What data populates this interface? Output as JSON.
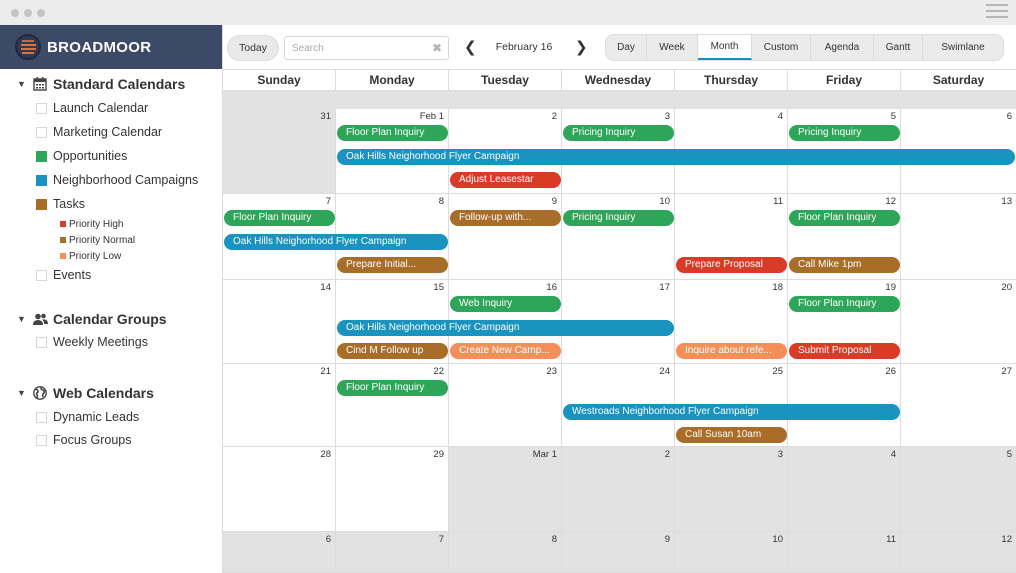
{
  "window": {
    "menu_icon": "hamburger-icon"
  },
  "brand": {
    "name": "BROADMOOR",
    "logo_icon": "broadmoor-logo-icon"
  },
  "colors": {
    "opportunities": "#2ea65a",
    "campaigns": "#1993bf",
    "tasks": "#a86d28",
    "priority_high": "#d93b27",
    "priority_normal": "#a86d28",
    "priority_low": "#f58f59",
    "brand_bg": "#3c4a68",
    "active_tab_underline": "#1a8ec0"
  },
  "sidebar": {
    "standard": {
      "title": "Standard Calendars",
      "icon": "calendar-icon",
      "items": [
        {
          "label": "Launch Calendar",
          "color": null
        },
        {
          "label": "Marketing Calendar",
          "color": null
        },
        {
          "label": "Opportunities",
          "color": "#2ea65a"
        },
        {
          "label": "Neighborhood Campaigns",
          "color": "#1993bf"
        },
        {
          "label": "Tasks",
          "color": "#a86d28"
        }
      ],
      "sub_items": [
        {
          "label": "Priority High",
          "color": "#d93b27"
        },
        {
          "label": "Priority Normal",
          "color": "#a86d28"
        },
        {
          "label": "Priority Low",
          "color": "#f58f59"
        }
      ],
      "events": {
        "label": "Events",
        "color": null
      }
    },
    "groups": {
      "title": "Calendar Groups",
      "icon": "users-icon",
      "items": [
        {
          "label": "Weekly Meetings"
        }
      ]
    },
    "web": {
      "title": "Web Calendars",
      "icon": "globe-icon",
      "items": [
        {
          "label": "Dynamic Leads"
        },
        {
          "label": "Focus Groups"
        }
      ]
    }
  },
  "toolbar": {
    "today_label": "Today",
    "search_placeholder": "Search",
    "search_value": "",
    "date_label": "February 16",
    "views": [
      "Day",
      "Week",
      "Month",
      "Custom",
      "Agenda",
      "Gantt",
      "Swimlane"
    ],
    "active_view": "Month"
  },
  "calendar": {
    "days_of_week": [
      "Sunday",
      "Monday",
      "Tuesday",
      "Wednesday",
      "Thursday",
      "Friday",
      "Saturday"
    ],
    "weeks": [
      {
        "days": [
          "31",
          "Feb 1",
          "2",
          "3",
          "4",
          "5",
          "6"
        ],
        "out": [
          true,
          false,
          false,
          false,
          false,
          false,
          false
        ],
        "events": [
          {
            "title": "Floor Plan Inquiry",
            "start": 1,
            "span": 1,
            "lane": 0,
            "type": "opportunities"
          },
          {
            "title": "Pricing Inquiry",
            "start": 3,
            "span": 1,
            "lane": 0,
            "type": "opportunities"
          },
          {
            "title": "Pricing Inquiry",
            "start": 5,
            "span": 1,
            "lane": 0,
            "type": "opportunities"
          },
          {
            "title": "Oak Hills Neighorhood Flyer Campaign",
            "start": 1,
            "span": 6,
            "lane": 1,
            "type": "campaigns"
          },
          {
            "title": "Adjust Leasestar",
            "start": 2,
            "span": 1,
            "lane": 2,
            "type": "priority_high"
          }
        ]
      },
      {
        "days": [
          "7",
          "8",
          "9",
          "10",
          "11",
          "12",
          "13"
        ],
        "out": [
          false,
          false,
          false,
          false,
          false,
          false,
          false
        ],
        "events": [
          {
            "title": "Floor Plan Inquiry",
            "start": 0,
            "span": 1,
            "lane": 0,
            "type": "opportunities"
          },
          {
            "title": "Follow-up with...",
            "start": 2,
            "span": 1,
            "lane": 0,
            "type": "priority_normal"
          },
          {
            "title": "Pricing Inquiry",
            "start": 3,
            "span": 1,
            "lane": 0,
            "type": "opportunities"
          },
          {
            "title": "Floor Plan Inquiry",
            "start": 5,
            "span": 1,
            "lane": 0,
            "type": "opportunities"
          },
          {
            "title": "Oak Hills Neighorhood Flyer Campaign",
            "start": 0,
            "span": 2,
            "lane": 1,
            "type": "campaigns"
          },
          {
            "title": "Prepare Initial...",
            "start": 1,
            "span": 1,
            "lane": 2,
            "type": "priority_normal"
          },
          {
            "title": "Prepare Proposal",
            "start": 4,
            "span": 1,
            "lane": 2,
            "type": "priority_high"
          },
          {
            "title": "Call Mike 1pm",
            "start": 5,
            "span": 1,
            "lane": 2,
            "type": "priority_normal"
          }
        ]
      },
      {
        "days": [
          "14",
          "15",
          "16",
          "17",
          "18",
          "19",
          "20"
        ],
        "out": [
          false,
          false,
          false,
          false,
          false,
          false,
          false
        ],
        "events": [
          {
            "title": "Web Inquiry",
            "start": 2,
            "span": 1,
            "lane": 0,
            "type": "opportunities"
          },
          {
            "title": "Floor Plan Inquiry",
            "start": 5,
            "span": 1,
            "lane": 0,
            "type": "opportunities"
          },
          {
            "title": "Oak Hills Neighorhood Flyer Campaign",
            "start": 1,
            "span": 3,
            "lane": 1,
            "type": "campaigns"
          },
          {
            "title": "Cind M Follow up",
            "start": 1,
            "span": 1,
            "lane": 2,
            "type": "priority_normal"
          },
          {
            "title": "Create New Camp...",
            "start": 2,
            "span": 1,
            "lane": 2,
            "type": "priority_low"
          },
          {
            "title": "Inquire about refe...",
            "start": 4,
            "span": 1,
            "lane": 2,
            "type": "priority_low"
          },
          {
            "title": "Submit Proposal",
            "start": 5,
            "span": 1,
            "lane": 2,
            "type": "priority_high"
          }
        ]
      },
      {
        "days": [
          "21",
          "22",
          "23",
          "24",
          "25",
          "26",
          "27"
        ],
        "out": [
          false,
          false,
          false,
          false,
          false,
          false,
          false
        ],
        "events": [
          {
            "title": "Floor Plan Inquiry",
            "start": 1,
            "span": 1,
            "lane": 0,
            "type": "opportunities"
          },
          {
            "title": "Westroads Neighborhood Flyer Campaign",
            "start": 3,
            "span": 3,
            "lane": 1,
            "type": "campaigns"
          },
          {
            "title": "Call Susan 10am",
            "start": 4,
            "span": 1,
            "lane": 2,
            "type": "priority_normal"
          }
        ]
      },
      {
        "days": [
          "28",
          "29",
          "Mar 1",
          "2",
          "3",
          "4",
          "5"
        ],
        "out": [
          false,
          false,
          true,
          true,
          true,
          true,
          true
        ],
        "events": []
      },
      {
        "days": [
          "6",
          "7",
          "8",
          "9",
          "10",
          "11",
          "12"
        ],
        "out": [
          true,
          true,
          true,
          true,
          true,
          true,
          true
        ],
        "events": []
      }
    ]
  }
}
